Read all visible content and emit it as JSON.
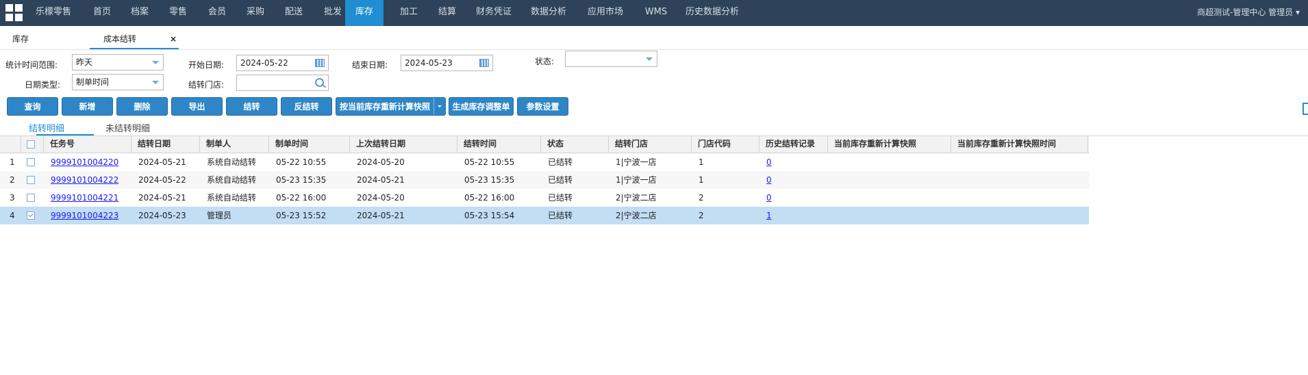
{
  "nav": {
    "items": [
      "乐檬零售",
      "首页",
      "档案",
      "零售",
      "会员",
      "采购",
      "配送",
      "批发",
      "库存",
      "加工",
      "结算",
      "财务凭证",
      "数据分析",
      "应用市场",
      "WMS",
      "历史数据分析"
    ],
    "active_index": 8,
    "user": "商超测试-管理中心 管理员 ▾"
  },
  "tabs": {
    "inventory": "库存",
    "cost_carryover": "成本结转",
    "close": "×"
  },
  "form": {
    "range_label": "统计时间范围:",
    "range_value": "昨天",
    "start_label": "开始日期:",
    "start_value": "2024-05-22",
    "end_label": "结束日期:",
    "end_value": "2024-05-23",
    "status_label": "状态:",
    "status_value": "",
    "date_type_label": "日期类型:",
    "date_type_value": "制单时间",
    "store_label": "结转门店:",
    "store_value": ""
  },
  "toolbar": {
    "query": "查询",
    "add": "新增",
    "delete": "删除",
    "export": "导出",
    "carry": "结转",
    "reverse": "反结转",
    "recalc": "按当前库存重新计算快照",
    "gen_adjust": "生成库存调整单",
    "params": "参数设置"
  },
  "subtabs": {
    "detail": "结转明细",
    "not_detail": "未结转明细"
  },
  "table": {
    "columns": [
      "任务号",
      "结转日期",
      "制单人",
      "制单时间",
      "上次结转日期",
      "结转时间",
      "状态",
      "结转门店",
      "门店代码",
      "历史结转记录",
      "当前库存重新计算快照",
      "当前库存重新计算快照时间"
    ],
    "rows": [
      {
        "num": "1",
        "checked": false,
        "task": "9999101004220",
        "date": "2024-05-21",
        "creator": "系统自动结转",
        "create_time": "05-22 10:55",
        "last_date": "2024-05-20",
        "carry_time": "05-22 10:55",
        "status": "已结转",
        "store": "1|宁波一店",
        "store_code": "1",
        "history": "0",
        "snapshot": "",
        "snapshot_time": ""
      },
      {
        "num": "2",
        "checked": false,
        "task": "9999101004222",
        "date": "2024-05-22",
        "creator": "系统自动结转",
        "create_time": "05-23 15:35",
        "last_date": "2024-05-21",
        "carry_time": "05-23 15:35",
        "status": "已结转",
        "store": "1|宁波一店",
        "store_code": "1",
        "history": "0",
        "snapshot": "",
        "snapshot_time": ""
      },
      {
        "num": "3",
        "checked": false,
        "task": "9999101004221",
        "date": "2024-05-21",
        "creator": "系统自动结转",
        "create_time": "05-22 16:00",
        "last_date": "2024-05-20",
        "carry_time": "05-22 16:00",
        "status": "已结转",
        "store": "2|宁波二店",
        "store_code": "2",
        "history": "0",
        "snapshot": "",
        "snapshot_time": ""
      },
      {
        "num": "4",
        "checked": true,
        "task": "9999101004223",
        "date": "2024-05-23",
        "creator": "管理员",
        "create_time": "05-23 15:52",
        "last_date": "2024-05-21",
        "carry_time": "05-23 15:54",
        "status": "已结转",
        "store": "2|宁波二店",
        "store_code": "2",
        "history": "1",
        "snapshot": "",
        "snapshot_time": ""
      }
    ],
    "row_bg": [
      "#ffffff",
      "#f7f7f7",
      "#ffffff",
      "#c3ddf3"
    ]
  }
}
